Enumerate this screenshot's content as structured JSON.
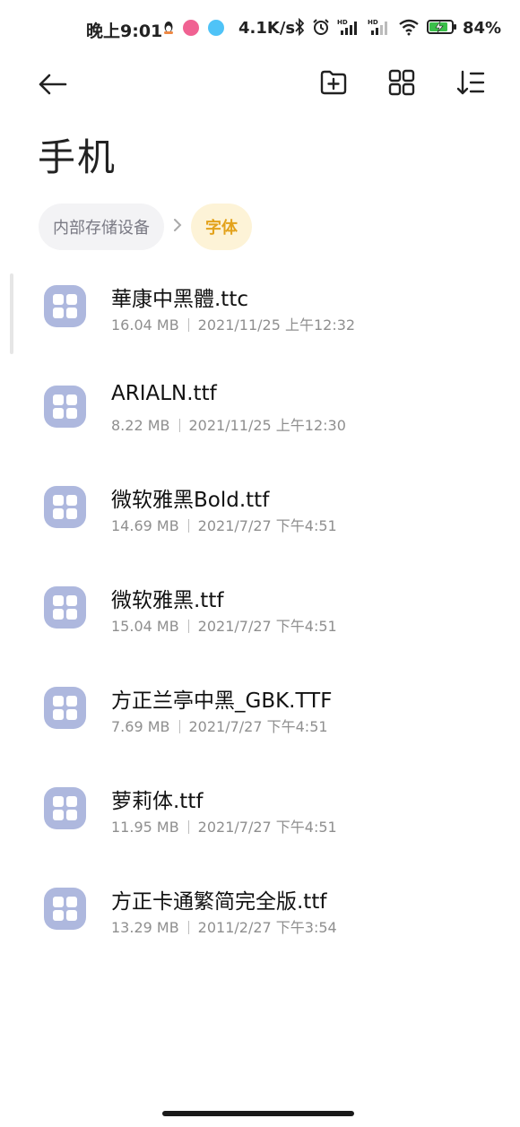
{
  "status_bar": {
    "time": "晚上9:01",
    "network_speed": "4.1K/s",
    "battery_percent": "84%",
    "icons": [
      "qq-icon",
      "pink-app-icon",
      "blue-app-icon",
      "bluetooth-icon",
      "alarm-icon",
      "hd-signal-icon",
      "hd-signal-icon",
      "wifi-icon",
      "battery-charging-icon"
    ]
  },
  "toolbar": {
    "back_icon": "back-arrow-icon",
    "new_folder_icon": "new-folder-icon",
    "grid_view_icon": "grid-view-icon",
    "sort_icon": "sort-icon"
  },
  "page": {
    "title": "手机"
  },
  "breadcrumb": {
    "root": "内部存储设备",
    "current": "字体"
  },
  "files": [
    {
      "name": "華康中黑體.ttc",
      "size": "16.04 MB",
      "date": "2021/11/25 上午12:32"
    },
    {
      "name": "ARIALN.ttf",
      "size": "8.22 MB",
      "date": "2021/11/25 上午12:30"
    },
    {
      "name": "微软雅黑Bold.ttf",
      "size": "14.69 MB",
      "date": "2021/7/27 下午4:51"
    },
    {
      "name": "微软雅黑.ttf",
      "size": "15.04 MB",
      "date": "2021/7/27 下午4:51"
    },
    {
      "name": "方正兰亭中黑_GBK.TTF",
      "size": "7.69 MB",
      "date": "2021/7/27 下午4:51"
    },
    {
      "name": "萝莉体.ttf",
      "size": "11.95 MB",
      "date": "2021/7/27 下午4:51"
    },
    {
      "name": "方正卡通繁简完全版.ttf",
      "size": "13.29 MB",
      "date": "2011/2/27 下午3:54"
    }
  ],
  "colors": {
    "accent": "#e3a21b",
    "file_icon": "#aeb8de"
  }
}
